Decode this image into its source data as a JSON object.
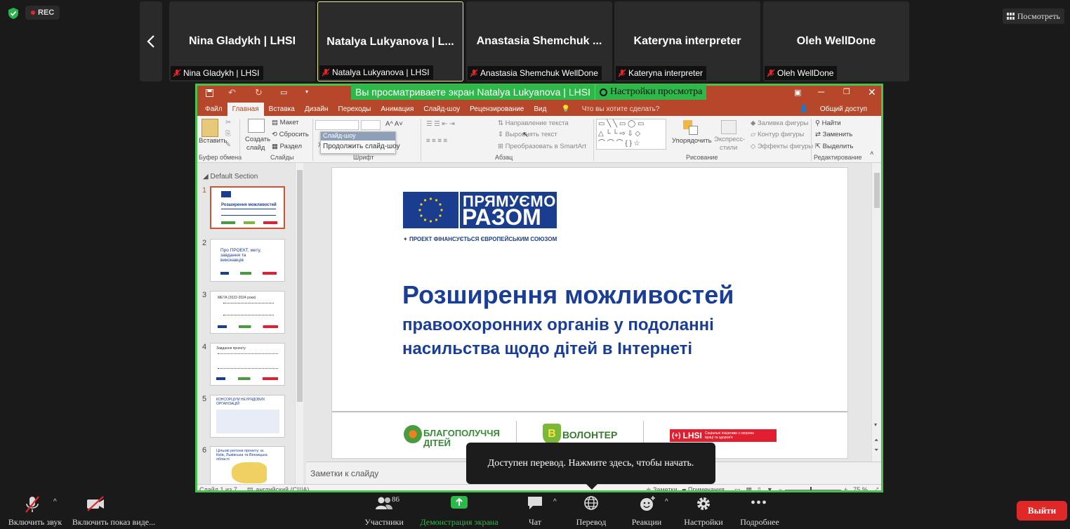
{
  "top": {
    "rec_label": "REC",
    "view_label": "Посмотреть",
    "participants": [
      {
        "display": "Nina Gladykh | LHSI",
        "label": "Nina Gladykh | LHSI",
        "active": false
      },
      {
        "display": "Natalya Lukyanova | L...",
        "label": "Natalya Lukyanova | LHSI",
        "active": true
      },
      {
        "display": "Anastasia Shemchuk ...",
        "label": "Anastasia Shemchuk WellDone",
        "active": false
      },
      {
        "display": "Kateryna interpreter",
        "label": "Kateryna interpreter",
        "active": false
      },
      {
        "display": "Oleh WellDone",
        "label": "Oleh WellDone",
        "active": false
      }
    ]
  },
  "share": {
    "banner_text": "Вы просматриваете экран Natalya Lukyanova | LHSI",
    "view_options": "Настройки просмотра"
  },
  "ppt": {
    "tabs": [
      "Файл",
      "Главная",
      "Вставка",
      "Дизайн",
      "Переходы",
      "Анимация",
      "Слайд-шоу",
      "Рецензирование",
      "Вид"
    ],
    "tell_me": "Что вы хотите сделать?",
    "share_label": "Общий доступ",
    "ribbon": {
      "paste": "Вставить",
      "clipboard": "Буфер обмена",
      "create_slide": "Создать",
      "create_slide2": "слайд",
      "layout": "Макет",
      "reset": "Сбросить",
      "section": "Раздел",
      "slides": "Слайды",
      "font": "Шрифт",
      "paragraph": "Абзац",
      "text_direction": "Направление текста",
      "align_text": "Выровнять текст",
      "smartart": "Преобразовать в SmartArt",
      "arrange": "Упорядочить",
      "express1": "Экспресс-",
      "express2": "стили",
      "fill": "Заливка фигуры",
      "outline": "Контур фигуры",
      "effects": "Эффекты фигуры",
      "drawing": "Рисование",
      "find": "Найти",
      "replace": "Заменить",
      "select": "Выделить",
      "editing": "Редактирование",
      "popup_title": "Слайд-шоу",
      "popup_item": "Продолжить слайд-шоу"
    },
    "section_name": "Default Section",
    "thumbs": [
      {
        "n": "1",
        "text": "Розширення можливостей"
      },
      {
        "n": "2",
        "text": "Про ПРОЕКТ, мету, завдання та виконавців"
      },
      {
        "n": "3",
        "text": "МЕТА (2022-2024 роки)"
      },
      {
        "n": "4",
        "text": "Завдання проекту"
      },
      {
        "n": "5",
        "text": "КОНСОРЦІУМ НЕУРЯДОВИХ ОРГАНІЗАЦІЙ"
      },
      {
        "n": "6",
        "text": "Цільові регіони проекту: м. Київ, Львівська та Вінницька області"
      }
    ],
    "slide": {
      "logo_line1": "ПРЯМУЄМО",
      "logo_line2": "РАЗОМ",
      "logo_sub": "ПРОЕКТ ФІНАНСУЄТЬСЯ ЄВРОПЕЙСЬКИМ СОЮЗОМ",
      "title": "Розширення можливостей",
      "subtitle1": "правоохоронних органів у подоланні",
      "subtitle2": "насильства щодо дітей в Інтернеті",
      "partner1a": "БЛАГОПОЛУЧЧЯ",
      "partner1b": "ДІТЕЙ",
      "partner2": "ВОЛОНТЕР",
      "partner3": "LHSI",
      "partner3_desc": "Соціальні ініціативи з охорони праці та здоров'я"
    },
    "notes_placeholder": "Заметки к слайду",
    "status": {
      "slide_info": "Слайд 1 из 7",
      "language": "английский (США)",
      "notes": "Заметки",
      "comments": "Примечания",
      "zoom": "75 %"
    }
  },
  "tooltip": "Доступен перевод. Нажмите здесь, чтобы начать.",
  "toolbar": {
    "mute": "Включить звук",
    "video": "Включить показ виде...",
    "participants": "Участники",
    "participants_count": "86",
    "share": "Демонстрация экрана",
    "chat": "Чат",
    "translate": "Перевод",
    "reactions": "Реакции",
    "settings": "Настройки",
    "more": "Подробнее",
    "leave": "Выйти"
  },
  "colors": {
    "accent_green": "#2fb84a",
    "ppt_red": "#b7472a",
    "leave_red": "#e02828",
    "eu_blue": "#1a3d8f",
    "slide_blue": "#1a3e97"
  }
}
